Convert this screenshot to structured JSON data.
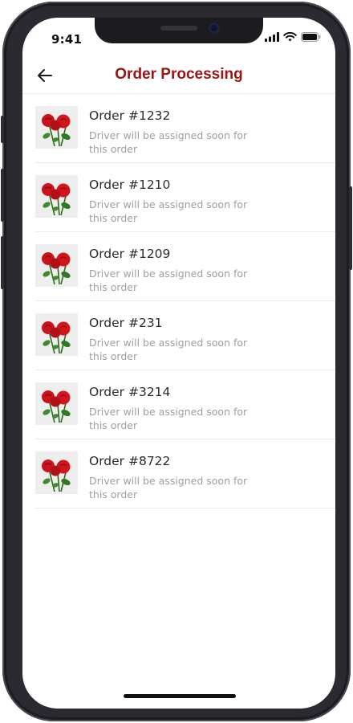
{
  "status_bar": {
    "time": "9:41",
    "icons": [
      "signal-icon",
      "wifi-icon",
      "battery-icon"
    ]
  },
  "header": {
    "title": "Order Processing",
    "back_icon": "arrow-left-icon"
  },
  "colors": {
    "title": "#9b1414",
    "order_title": "#2b2b2b",
    "order_desc": "#9e9e9e",
    "rose": "#d3161c"
  },
  "orders": [
    {
      "title": "Order #1232",
      "desc": "Driver will be assigned soon for this  order",
      "image": "roses-thumbnail"
    },
    {
      "title": "Order #1210",
      "desc": "Driver will be assigned soon for this  order",
      "image": "roses-thumbnail"
    },
    {
      "title": "Order #1209",
      "desc": "Driver will be assigned soon for this  order",
      "image": "roses-thumbnail"
    },
    {
      "title": "Order #231",
      "desc": "Driver will be assigned soon for this  order",
      "image": "roses-thumbnail"
    },
    {
      "title": "Order #3214",
      "desc": "Driver will be assigned soon for this  order",
      "image": "roses-thumbnail"
    },
    {
      "title": "Order #8722",
      "desc": "Driver will be assigned soon for this  order",
      "image": "roses-thumbnail"
    }
  ]
}
